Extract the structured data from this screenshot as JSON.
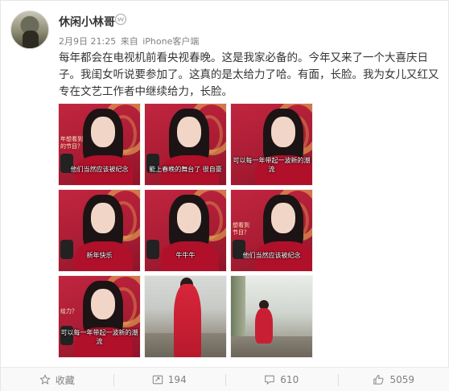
{
  "post": {
    "username": "休闲小林哥",
    "meta": {
      "date": "2月9日 21:25",
      "from_label": "来自",
      "client": "iPhone客户端"
    },
    "text": "每年都会在电视机前看央视春晚。这是我家必备的。今年又来了一个大喜庆日子。我闺女听说要参加了。这真的是太给力了哈。有面，长脸。我为女儿又红又专在文艺工作者中继续给力，长脸。"
  },
  "images": [
    {
      "caption": "他们当然应该被纪念",
      "side": "年想看到\n的节目？"
    },
    {
      "caption": "能上春晚的舞台了 很自豪",
      "side": ""
    },
    {
      "caption": "可以每一年带起一波新的潮流",
      "side": ""
    },
    {
      "caption": "新年快乐",
      "side": ""
    },
    {
      "caption": "牛牛牛",
      "side": ""
    },
    {
      "caption": "他们当然应该被纪念",
      "side": "想看到\n节目？"
    },
    {
      "caption": "可以每一年带起一波新的潮流",
      "side": "给力？"
    },
    {
      "caption": "",
      "side": ""
    },
    {
      "caption": "",
      "side": ""
    }
  ],
  "actions": {
    "favorite_label": "收藏",
    "repost_count": "194",
    "comment_count": "610",
    "like_count": "5059"
  },
  "icons": {
    "vip": "vip-badge-icon",
    "favorite": "star-icon",
    "repost": "repost-icon",
    "comment": "comment-icon",
    "like": "thumbs-up-icon"
  }
}
